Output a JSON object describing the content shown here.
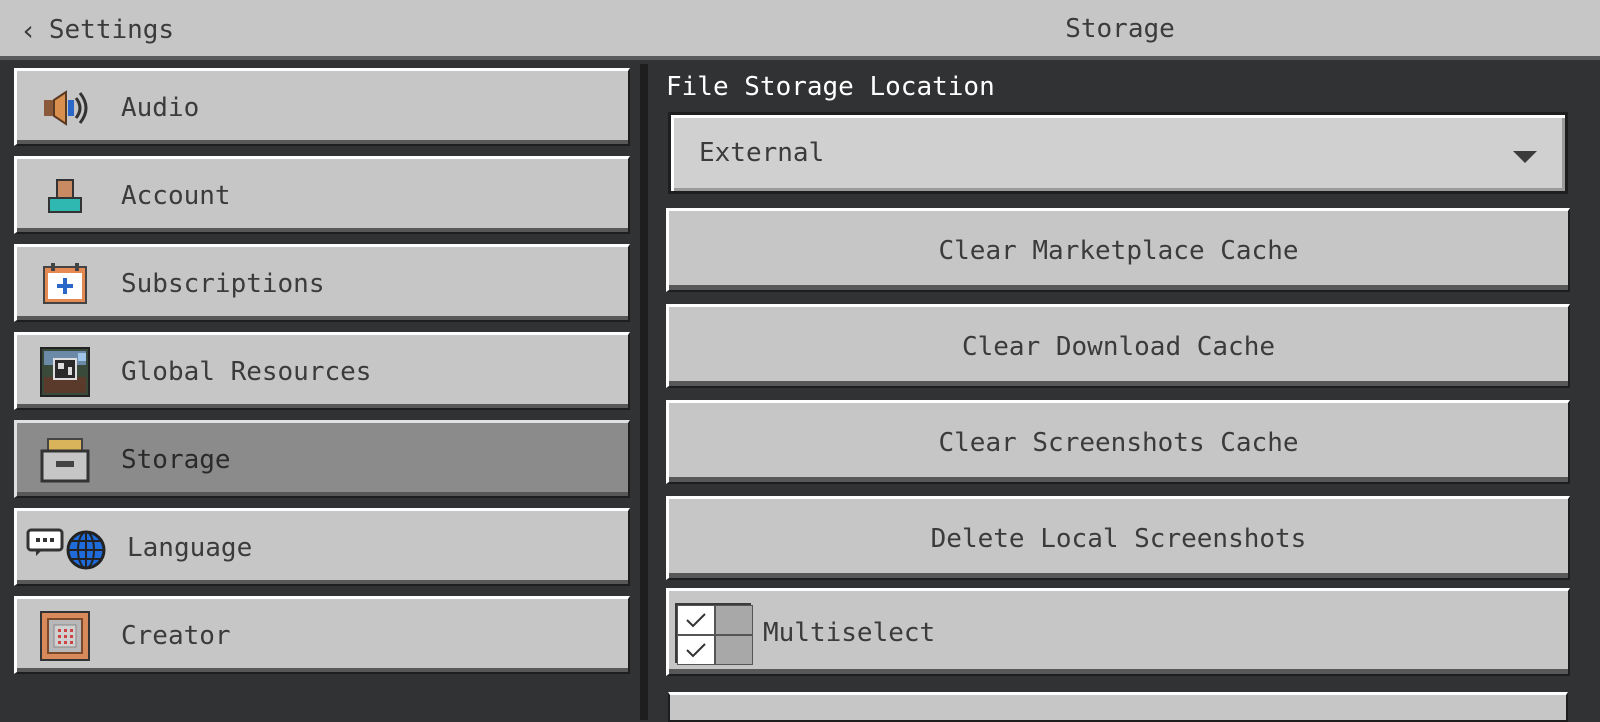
{
  "header": {
    "back_label": "Settings",
    "title": "Storage"
  },
  "sidebar": {
    "items": [
      {
        "label": "Audio",
        "icon": "speaker-icon"
      },
      {
        "label": "Account",
        "icon": "account-icon"
      },
      {
        "label": "Subscriptions",
        "icon": "calendar-plus-icon"
      },
      {
        "label": "Global Resources",
        "icon": "resource-pack-icon"
      },
      {
        "label": "Storage",
        "icon": "storage-box-icon",
        "selected": true
      },
      {
        "label": "Language",
        "icon": "language-globe-icon"
      },
      {
        "label": "Creator",
        "icon": "command-block-icon"
      }
    ]
  },
  "main": {
    "section_label": "File Storage Location",
    "dropdown_value": "External",
    "buttons": {
      "clear_marketplace": "Clear Marketplace Cache",
      "clear_download": "Clear Download Cache",
      "clear_screenshots": "Clear Screenshots Cache",
      "delete_screenshots": "Delete Local Screenshots"
    },
    "multiselect_label": "Multiselect"
  },
  "colors": {
    "panel": "#c6c6c6",
    "selected": "#8b8b8b",
    "background": "#313233",
    "text": "#3b3b3b"
  }
}
